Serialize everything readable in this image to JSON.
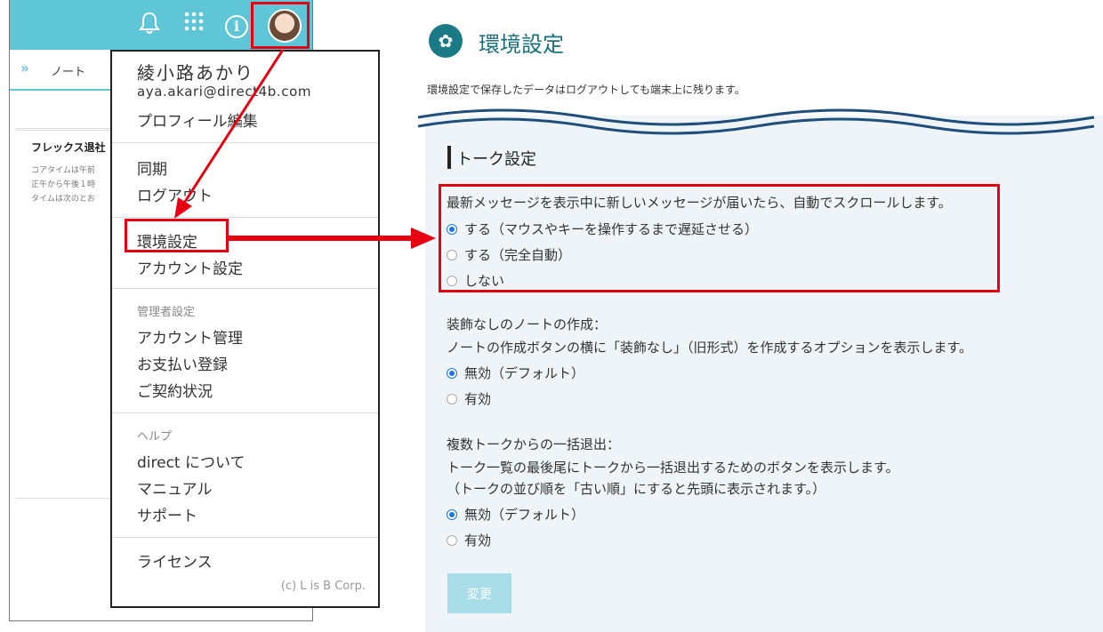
{
  "left_app": {
    "tab_label": "ノート",
    "note_title": "フレックス退社",
    "note_lines": [
      "コアタイムは午前",
      "正午から午後１時",
      "タイムは次のとお"
    ]
  },
  "menu": {
    "user_name": "綾小路あかり",
    "user_email": "aya.akari@direct4b.com",
    "profile_edit": "プロフィール編集",
    "sync": "同期",
    "logout": "ログアウト",
    "environment_settings": "環境設定",
    "account_settings": "アカウント設定",
    "admin_header": "管理者設定",
    "account_management": "アカウント管理",
    "payment_registration": "お支払い登録",
    "contract_status": "ご契約状況",
    "help_header": "ヘルプ",
    "about": "direct について",
    "manual": "マニュアル",
    "support": "サポート",
    "license": "ライセンス",
    "copyright": "(c) L is B Corp."
  },
  "settings": {
    "title": "環境設定",
    "description": "環境設定で保存したデータはログアウトしても端末上に残ります。",
    "section_title": "トーク設定",
    "auto_scroll": {
      "description": "最新メッセージを表示中に新しいメッセージが届いたら、自動でスクロールします。",
      "options": [
        "する（マウスやキーを操作するまで遅延させる）",
        "する（完全自動）",
        "しない"
      ],
      "selected_index": 0
    },
    "plain_note": {
      "title": "装飾なしのノートの作成：",
      "description": "ノートの作成ボタンの横に「装飾なし」（旧形式）を作成するオプションを表示します。",
      "options": [
        "無効（デフォルト）",
        "有効"
      ],
      "selected_index": 0
    },
    "bulk_exit": {
      "title": "複数トークからの一括退出：",
      "description_1": "トーク一覧の最後尾にトークから一括退出するためのボタンを表示します。",
      "description_2": "（トークの並び順を「古い順」にすると先頭に表示されます。）",
      "options": [
        "無効（デフォルト）",
        "有効"
      ],
      "selected_index": 0
    },
    "change_button": "変更"
  },
  "colors": {
    "header_teal": "#5fc6d8",
    "title_teal": "#1a6f7a",
    "highlight_red": "#e60012",
    "button_disabled": "#a9dde8"
  },
  "icons": [
    "bell-icon",
    "apps-grid-icon",
    "info-icon",
    "avatar",
    "chevron-double-right-icon",
    "gear-icon"
  ]
}
